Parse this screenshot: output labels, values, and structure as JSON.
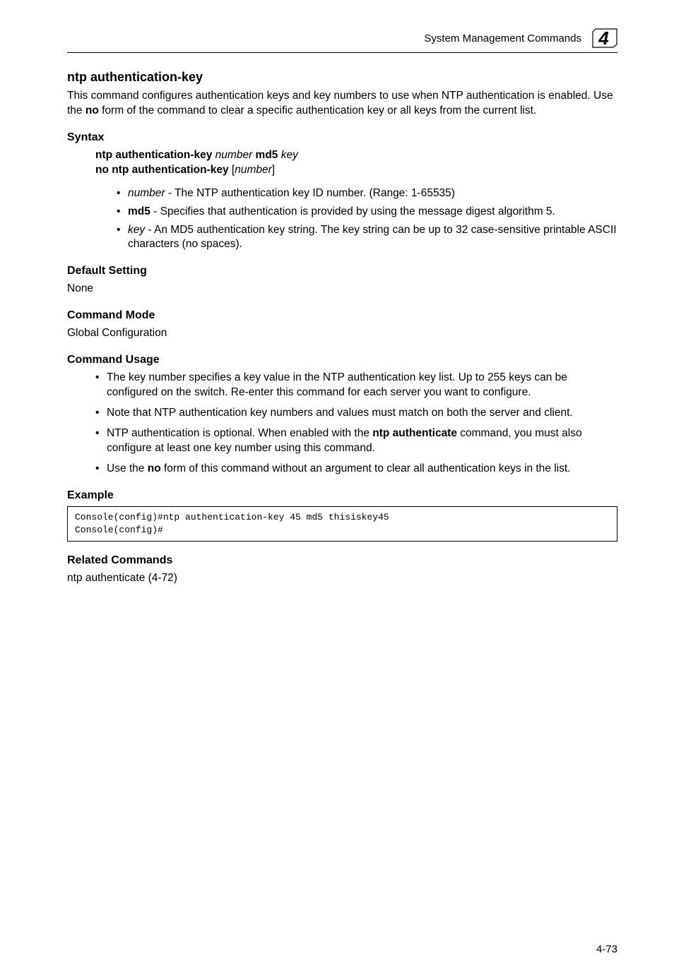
{
  "header": {
    "running_title": "System Management Commands",
    "chapter_number": "4"
  },
  "section": {
    "title": "ntp authentication-key",
    "intro": "This command configures authentication keys and key numbers to use when NTP authentication is enabled. Use the "
  },
  "intro_bold": "no",
  "intro_cont": " form of the command to clear a specific authentication key or all keys from the current list.",
  "syntax": {
    "heading": "Syntax",
    "line1_b1": "ntp authentication-key",
    "line1_i1": "number",
    "line1_b2": "md5",
    "line1_i2": "key",
    "line2_b1": "no ntp authentication-key",
    "line2_plain": " [",
    "line2_i1": "number",
    "line2_close": "]",
    "bullets": {
      "b1_i": "number",
      "b1_rest": " - The NTP authentication key ID number. (Range: 1-65535)",
      "b2_b": "md5",
      "b2_rest": " - Specifies that authentication is provided by using the message digest algorithm 5.",
      "b3_i": "key",
      "b3_rest": " - An MD5 authentication key string. The key string can be up to 32 case-sensitive printable ASCII characters (no spaces)."
    }
  },
  "default_setting": {
    "heading": "Default Setting",
    "value": "None"
  },
  "command_mode": {
    "heading": "Command Mode",
    "value": "Global Configuration"
  },
  "command_usage": {
    "heading": "Command Usage",
    "b1": "The key number specifies a key value in the NTP authentication key list. Up to 255 keys can be configured on the switch. Re-enter this command for each server you want to configure.",
    "b2": "Note that NTP authentication key numbers and values must match on both the server and client.",
    "b3_pre": "NTP authentication is optional. When enabled with the ",
    "b3_bold": "ntp authenticate",
    "b3_post": " command, you must also configure at least one key number using this command.",
    "b4_pre": "Use the ",
    "b4_bold": "no",
    "b4_post": " form of this command without an argument to clear all authentication keys in the list."
  },
  "example": {
    "heading": "Example",
    "code": "Console(config)#ntp authentication-key 45 md5 thisiskey45\nConsole(config)#"
  },
  "related": {
    "heading": "Related Commands",
    "value": "ntp authenticate (4-72)"
  },
  "footer": {
    "page_number": "4-73"
  }
}
